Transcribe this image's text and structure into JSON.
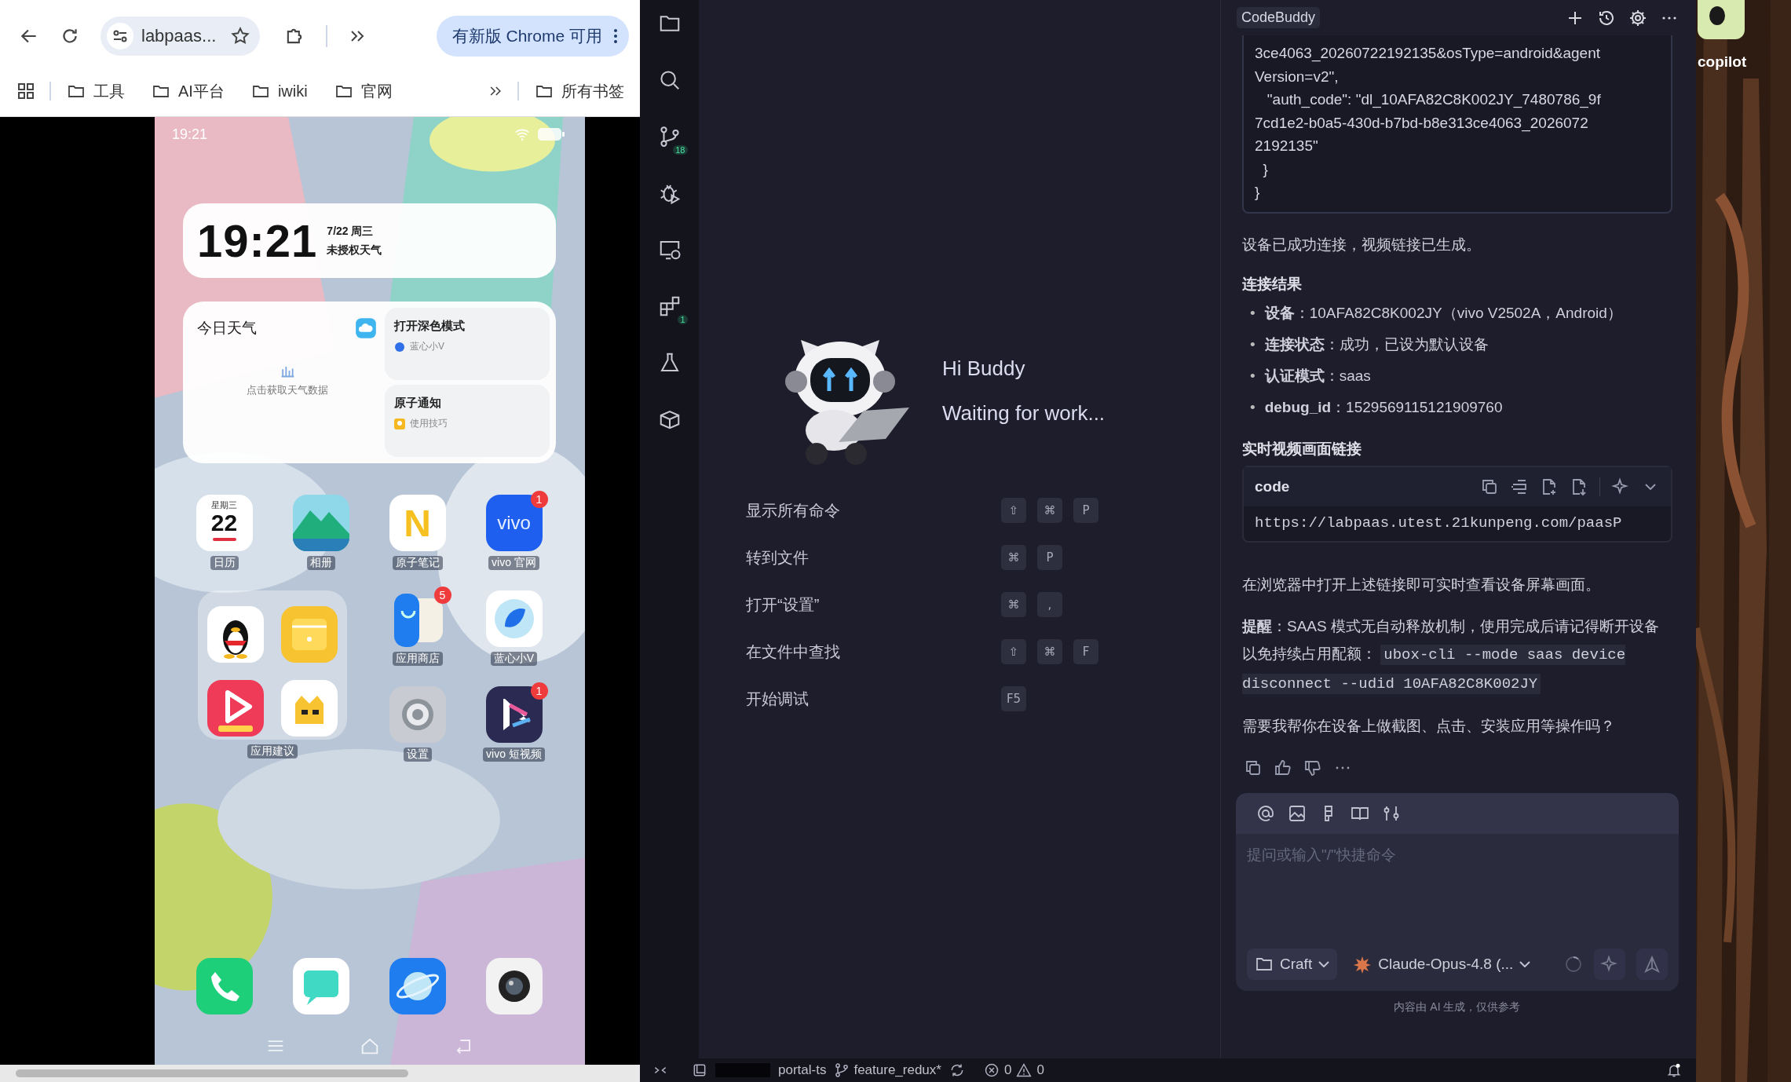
{
  "browser": {
    "address": "labpaas...",
    "update_button": "有新版 Chrome 可用",
    "bookmarks": [
      {
        "label": "工具"
      },
      {
        "label": "AI平台"
      },
      {
        "label": "iwiki"
      },
      {
        "label": "官网"
      }
    ],
    "all_bookmarks": "所有书签"
  },
  "phone": {
    "status_time": "19:21",
    "clock": {
      "time": "19:21",
      "date": "7/22 周三",
      "weather": "未授权天气"
    },
    "weather_widget": {
      "title": "今日天气",
      "hint": "点击获取天气数据"
    },
    "shortcuts": [
      {
        "title": "打开深色模式",
        "subtitle": "蓝心小V",
        "kind": "assistant"
      },
      {
        "title": "原子通知",
        "subtitle": "使用技巧",
        "kind": "tips"
      }
    ],
    "apps": [
      {
        "kind": "calendar",
        "label": "日历",
        "weekday": "星期三",
        "day": "22"
      },
      {
        "kind": "gallery",
        "label": "相册"
      },
      {
        "kind": "notes",
        "label": "原子笔记",
        "logo_text": "N"
      },
      {
        "kind": "vivo",
        "label": "vivo 官网",
        "logo_text": "vivo",
        "badge": "1"
      },
      {
        "kind": "folder",
        "label": "应用建议",
        "apps": [
          {
            "kind": "penguin"
          },
          {
            "kind": "wallet"
          },
          {
            "kind": "video"
          },
          {
            "kind": "game"
          }
        ]
      },
      {
        "kind": "store",
        "label": "应用商店",
        "badge": "5"
      },
      {
        "kind": "assistant",
        "label": "蓝心小V"
      },
      {
        "kind": "settings",
        "label": "设置"
      },
      {
        "kind": "shortvideo",
        "label": "vivo 短视频",
        "badge": "1"
      }
    ],
    "dock": [
      {
        "kind": "phone"
      },
      {
        "kind": "messages"
      },
      {
        "kind": "browser"
      },
      {
        "kind": "camera"
      }
    ]
  },
  "activity_bar": [
    {
      "kind": "explorer"
    },
    {
      "kind": "search"
    },
    {
      "kind": "source-control",
      "badge": "18"
    },
    {
      "kind": "debug"
    },
    {
      "kind": "remote"
    },
    {
      "kind": "extensions",
      "badge": "1"
    },
    {
      "kind": "testing"
    },
    {
      "kind": "packages"
    }
  ],
  "welcome": {
    "greeting": "Hi Buddy",
    "status": "Waiting for work...",
    "commands": [
      {
        "label": "显示所有命令",
        "keys": [
          "⇧",
          "⌘",
          "P"
        ]
      },
      {
        "label": "转到文件",
        "keys": [
          "⌘",
          "P"
        ]
      },
      {
        "label": "打开“设置”",
        "keys": [
          "⌘",
          ","
        ]
      },
      {
        "label": "在文件中查找",
        "keys": [
          "⇧",
          "⌘",
          "F"
        ]
      },
      {
        "label": "开始调试",
        "keys": [
          "F5"
        ]
      }
    ]
  },
  "chat": {
    "title": "CodeBuddy",
    "json_lines": [
      "3ce4063_20260722192135&osType=android&agent",
      "Version=v2\",",
      "   \"auth_code\": \"dl_10AFA82C8K002JY_7480786_9f",
      "7cd1e2-b0a5-430d-b7bd-b8e313ce4063_2026072",
      "2192135\"",
      "  }",
      "}"
    ],
    "status_text": "设备已成功连接，视频链接已生成。",
    "result_heading": "连接结果",
    "results": [
      {
        "marker": "•",
        "text": "**设备**：10AFA82C8K002JY（vivo V2502A，Android）"
      },
      {
        "marker": "•",
        "text": "**连接状态**：成功，已设为默认设备"
      },
      {
        "marker": "•",
        "text": "**认证模式**：saas"
      },
      {
        "marker": "•",
        "text": "**debug_id**：1529569115121909760"
      }
    ],
    "link_heading": "实时视频画面链接",
    "code_label": "code",
    "link": "https://labpaas.utest.21kunpeng.com/paasP",
    "open_hint": "在浏览器中打开上述链接即可实时查看设备屏幕画面。",
    "tip": {
      "text": "**提醒**：SAAS 模式无自动释放机制，使用完成后请记得断开设备以免持续占用配额：",
      "code": "ubox-cli --mode saas device disconnect --udid 10AFA82C8K002JY"
    },
    "question": "需要我帮你在设备上做截图、点击、安装应用等操作吗？",
    "input": {
      "placeholder": "提问或输入\"/\"快捷命令",
      "mode": "Craft",
      "model": "Claude-Opus-4.8 (..."
    },
    "disclaimer": "内容由 AI 生成，仅供参考"
  },
  "status_bar": {
    "project": "portal-ts",
    "branch": "feature_redux*",
    "errors": "0",
    "warnings": "0"
  },
  "desktop": {
    "app_label": "copilot"
  }
}
